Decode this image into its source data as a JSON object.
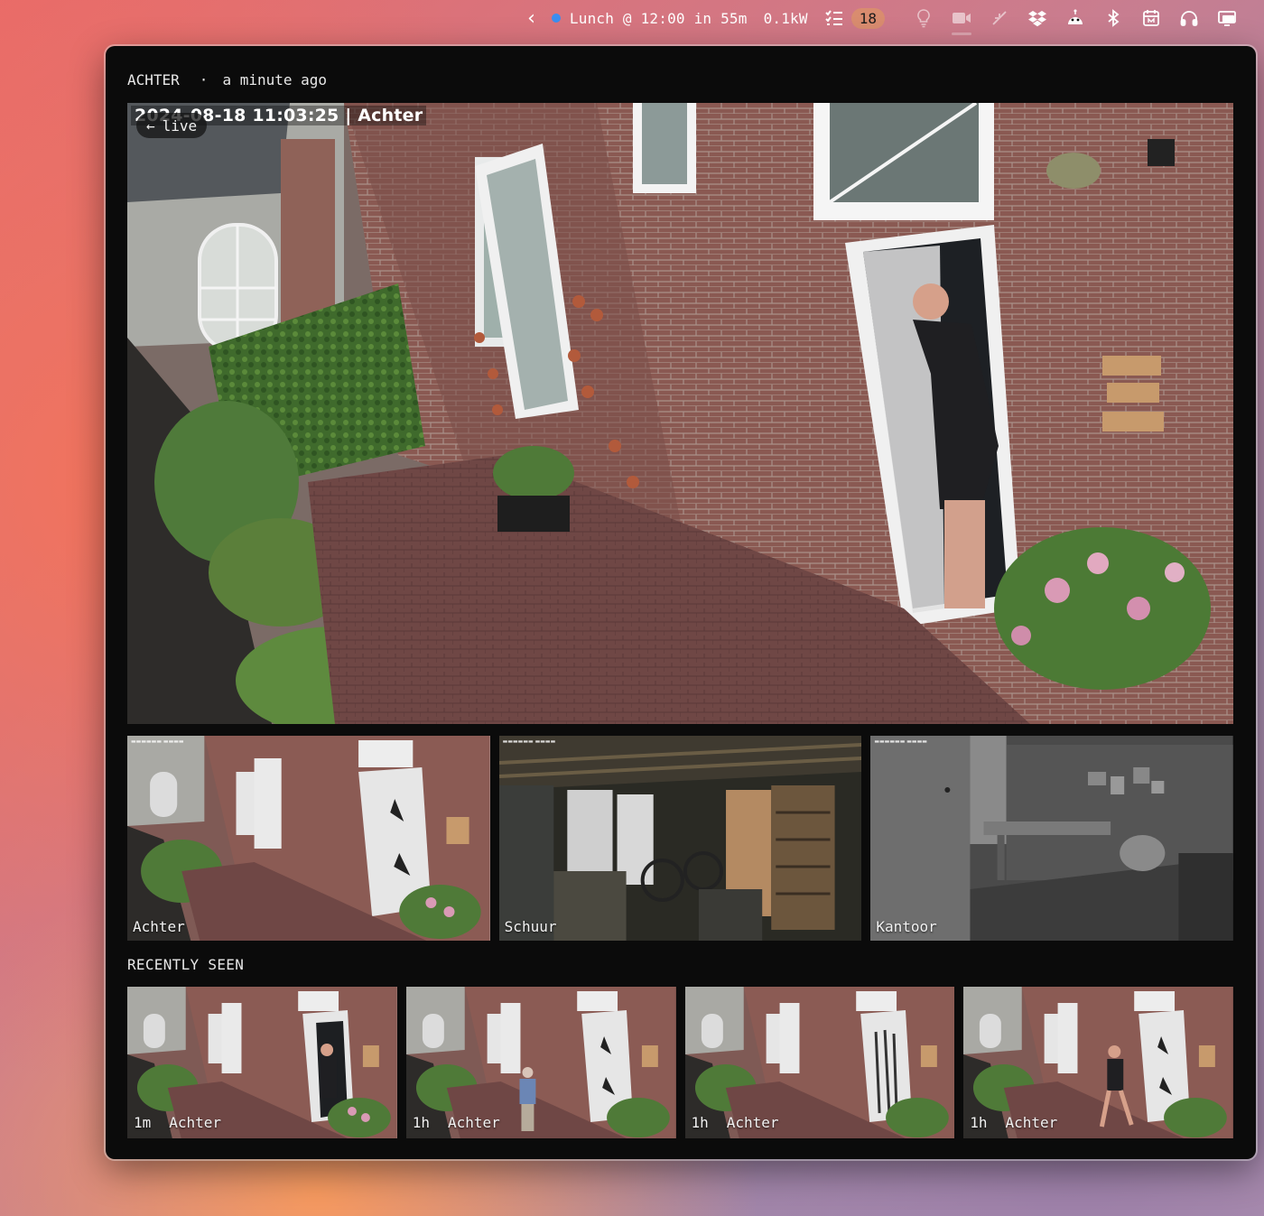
{
  "menubar": {
    "event_text": "Lunch @ 12:00 in 55m",
    "power_text": "0.1kW",
    "tasks_count": "18",
    "icons": [
      "chevron-left-icon",
      "calendar-dot-icon",
      "tasks-icon",
      "lightbulb-icon",
      "camera-icon",
      "mute-icon",
      "dropbox-icon",
      "robot-icon",
      "bluetooth-icon",
      "calendar-icon",
      "headphones-icon",
      "screen-mirroring-icon"
    ]
  },
  "header": {
    "camera_name": "ACHTER",
    "separator": "·",
    "updated": "a minute ago"
  },
  "main_view": {
    "live_label": "live",
    "timestamp": "2024-08-18 11:03:25 | Achter"
  },
  "cameras": [
    {
      "label": "Achter",
      "selected": true
    },
    {
      "label": "Schuur",
      "selected": false
    },
    {
      "label": "Kantoor",
      "selected": false
    }
  ],
  "recently_seen": {
    "title": "RECENTLY SEEN",
    "items": [
      {
        "age": "1m",
        "camera": "Achter",
        "selected": true
      },
      {
        "age": "1h",
        "camera": "Achter",
        "selected": false
      },
      {
        "age": "1h",
        "camera": "Achter",
        "selected": false
      },
      {
        "age": "1h",
        "camera": "Achter",
        "selected": false
      }
    ]
  },
  "colors": {
    "window_bg": "#0b0b0b",
    "accent_dot": "#3b8ef0",
    "badge": "#d98c6f",
    "brick": "#8b5a52"
  }
}
